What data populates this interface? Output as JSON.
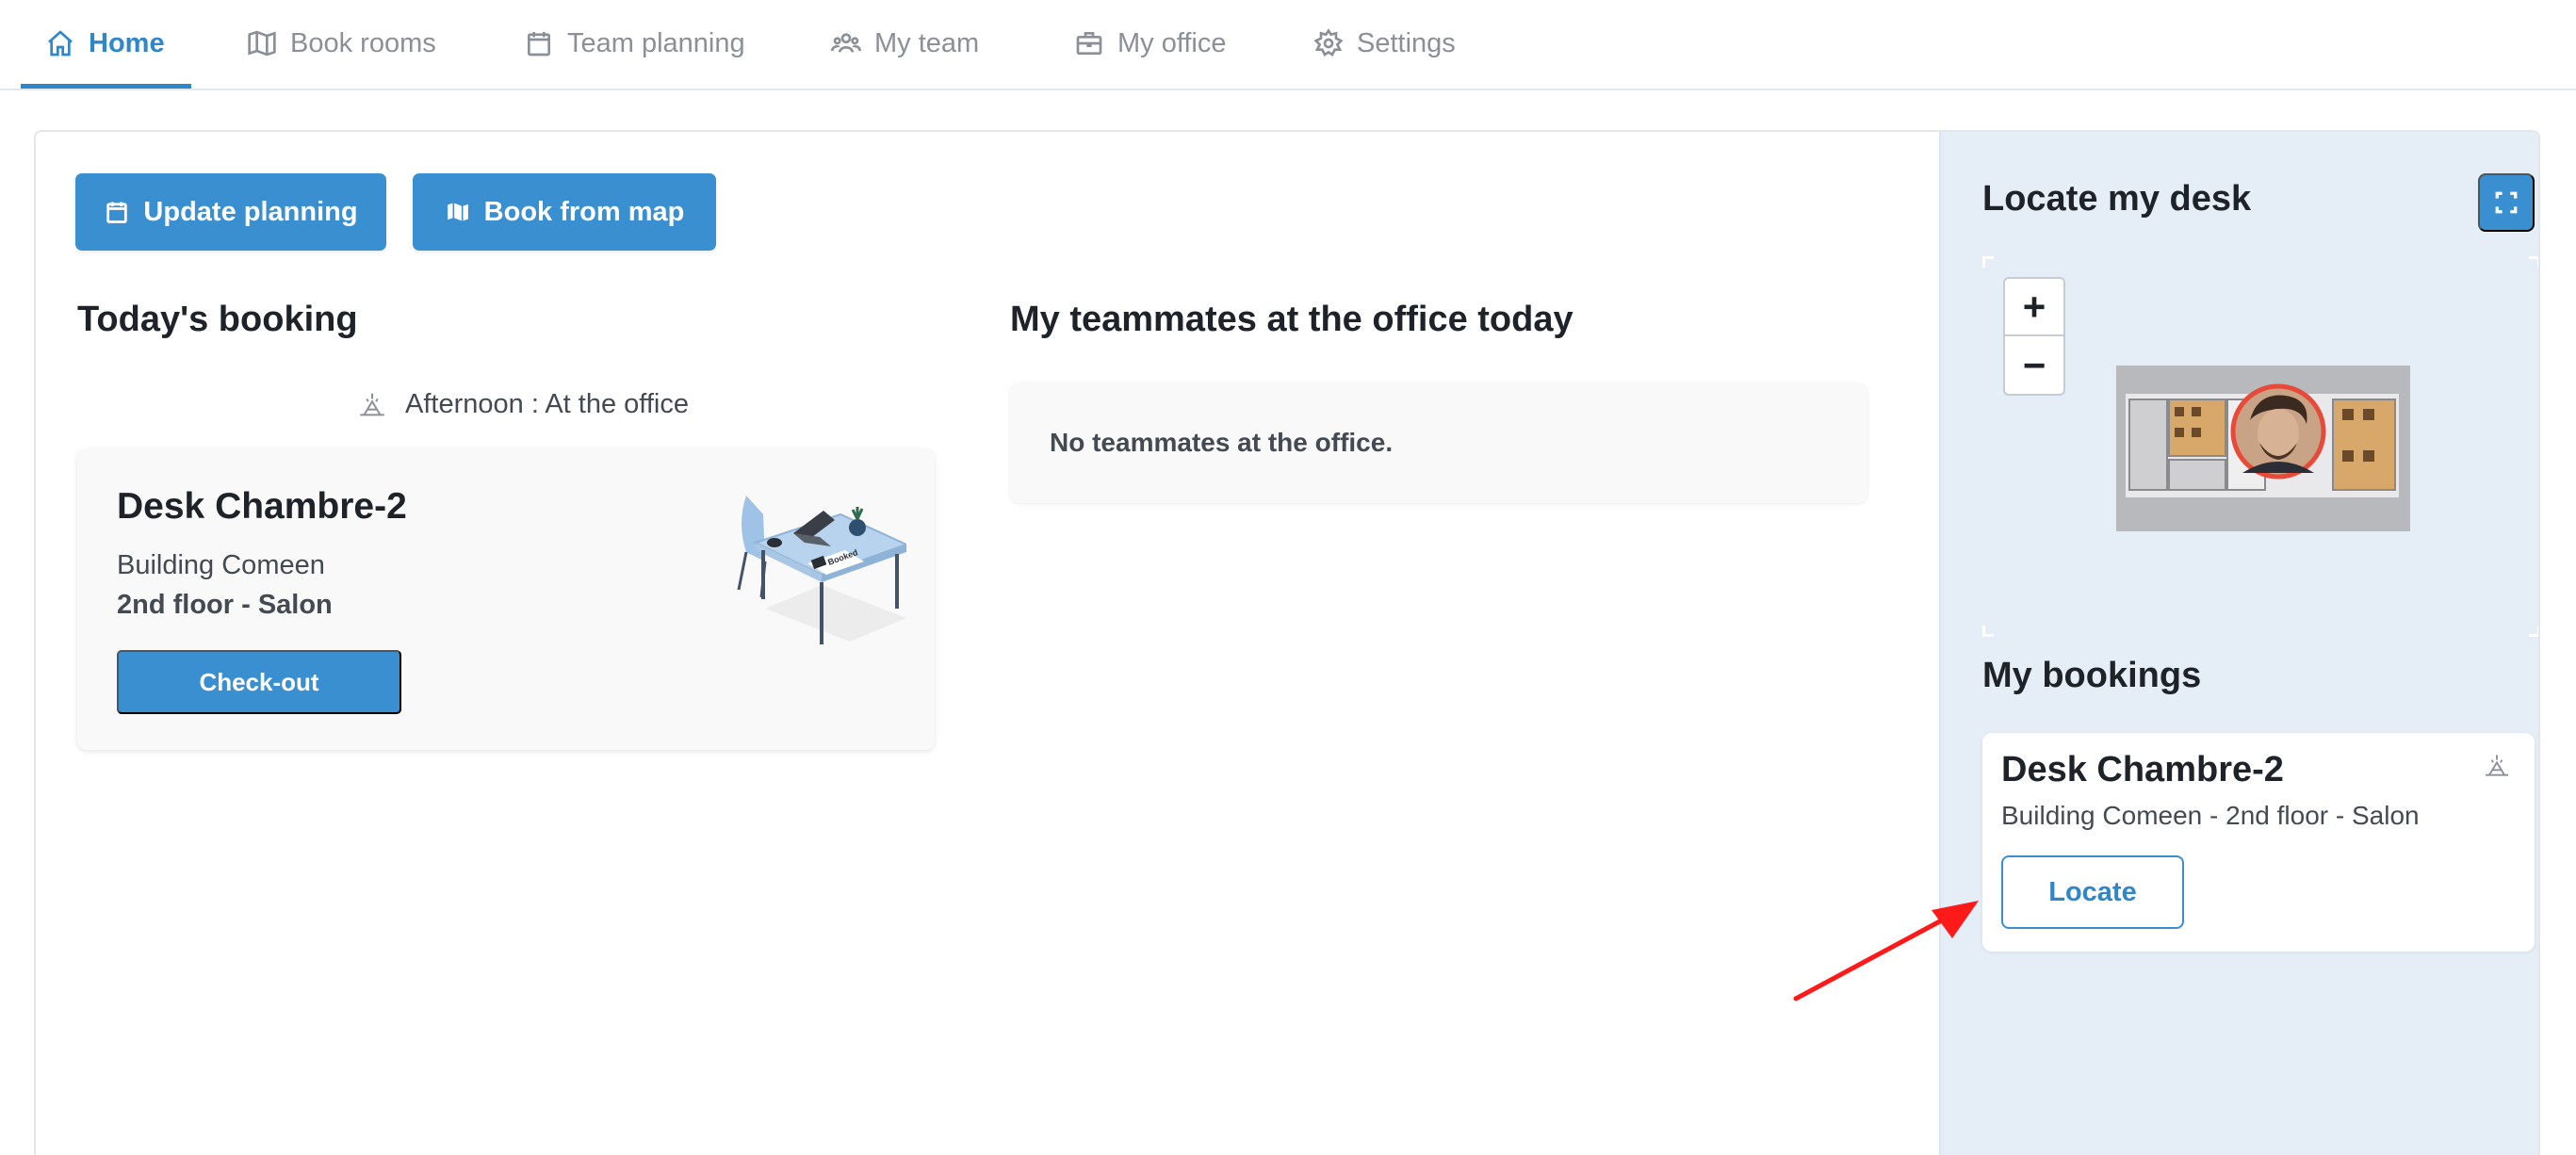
{
  "nav": {
    "tabs": [
      {
        "label": "Home",
        "icon": "home-icon",
        "active": true
      },
      {
        "label": "Book rooms",
        "icon": "map-icon",
        "active": false
      },
      {
        "label": "Team planning",
        "icon": "calendar-icon",
        "active": false
      },
      {
        "label": "My team",
        "icon": "team-icon",
        "active": false
      },
      {
        "label": "My office",
        "icon": "briefcase-icon",
        "active": false
      },
      {
        "label": "Settings",
        "icon": "gear-icon",
        "active": false
      }
    ]
  },
  "actions": {
    "update_planning": "Update planning",
    "book_from_map": "Book from map"
  },
  "todays_booking": {
    "title": "Today's booking",
    "status": "Afternoon : At the office",
    "desk_name": "Desk Chambre-2",
    "building": "Building Comeen",
    "floor": "2nd floor - Salon",
    "checkout_label": "Check-out"
  },
  "teammates": {
    "title": "My teammates at the office today",
    "empty_message": "No teammates at the office."
  },
  "locate": {
    "title": "Locate my desk",
    "zoom_in": "+",
    "zoom_out": "−"
  },
  "my_bookings": {
    "title": "My bookings",
    "desk_name": "Desk Chambre-2",
    "address": "Building Comeen - 2nd floor - Salon",
    "locate_label": "Locate"
  },
  "colors": {
    "accent": "#3a8fd0",
    "panel_bg": "#e5eef7",
    "annotation_arrow": "#ff1a1a"
  }
}
